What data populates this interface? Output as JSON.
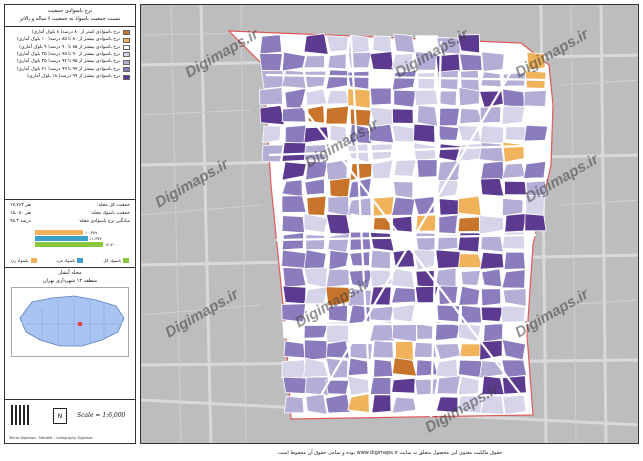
{
  "legend": {
    "title": "نرخ باسوادی جمعیت",
    "subtitle": "نسبت جمعیت باسواد به جمعیت ۶ ساله و بالاتر",
    "classes": [
      {
        "label": "نرخ باسوادی کمتر از ۸۰ درصد( ۸ بلوک آماری)",
        "color": "#c8742b"
      },
      {
        "label": "نرخ باسوادی بیشتر از ۸۰ تا ۸۵ درصد( ۱۰ بلوک آماری)",
        "color": "#f0b25a"
      },
      {
        "label": "نرخ باسوادی بیشتر از ۸۵ تا ۹۰ درصد( ۹ بلوک آماری)",
        "color": "#ffffff"
      },
      {
        "label": "نرخ باسوادی بیشتر از ۹۰ تا ۹۵ درصد( ۲۵ بلوک آماری)",
        "color": "#d6d4e8"
      },
      {
        "label": "نرخ باسوادی بیشتر از ۹۵ تا ۹۷ درصد( ۳۵ بلوک آماری)",
        "color": "#b4add6"
      },
      {
        "label": "نرخ باسوادی بیشتر از ۹۷ تا ۹۹ درصد( ۴۱ بلوک آماری)",
        "color": "#8b7dbd"
      },
      {
        "label": "نرخ باسوادی بیشتر از ۹۹ درصد( ۱۸ بلوک آماری)",
        "color": "#5b3a8f"
      }
    ],
    "stats": [
      {
        "key": "جمعیت کل محله:",
        "value": "۱۷،۷۶۳ نفر"
      },
      {
        "key": "جمعیت باسواد محله:",
        "value": "۱۵،۰۸۰ نفر"
      },
      {
        "key": "میانگین نرخ باسوادی محله:",
        "value": "۹۵.۳ درصد"
      }
    ],
    "bars": [
      {
        "label": "۱۰،۳۸۹",
        "value": 10389,
        "color": "#f0b25a"
      },
      {
        "label": "۱۱،۳۷۴",
        "value": 11374,
        "color": "#3aa0c8"
      },
      {
        "label": "۱۴،۷۰۰",
        "value": 14700,
        "color": "#8cc63f"
      }
    ],
    "categories": [
      {
        "label": "باسواد زن",
        "color": "#f0b25a"
      },
      {
        "label": "باسواد مرد",
        "color": "#3aa0c8"
      },
      {
        "label": "باسواد کل",
        "color": "#8cc63f"
      }
    ],
    "location_title": "محله آبشار",
    "location_subtitle": "منطقه ۱۲ شهرداری تهران",
    "scale": "Scale = 1:6,000",
    "credit": "Tehran Digimaps - Mahallat - Cartography: Digimaps"
  },
  "map": {
    "disclaimer": "حقوق مالکیت معنوی این محصول متعلق به سایت www.digimaps.ir بوده و تمامی حقوق آن محفوظ است.",
    "watermark": "Digimaps.ir",
    "boundary_color": "#e05a5a",
    "base_color": "#bdbdbd"
  }
}
